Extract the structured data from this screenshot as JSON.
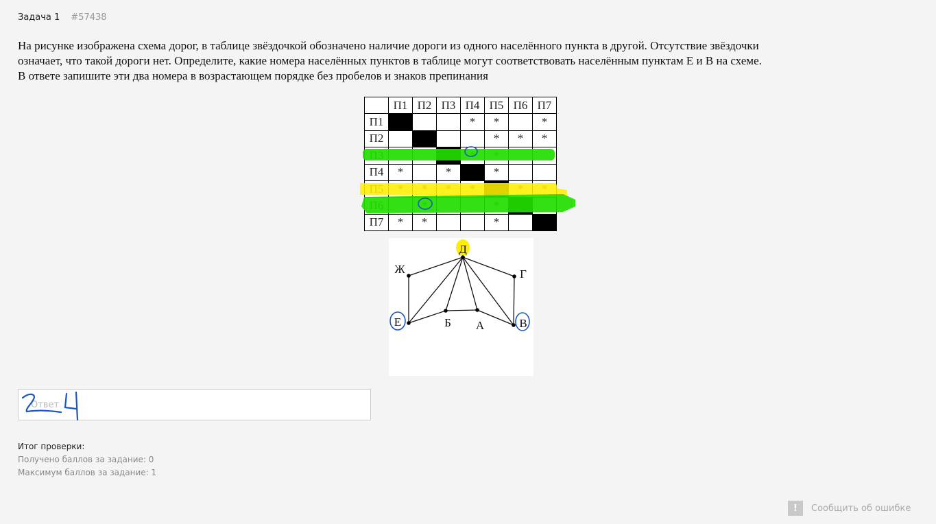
{
  "task": {
    "title": "Задача 1",
    "number": "#57438"
  },
  "question": {
    "line1": "На рисунке изображена схема дорог, в таблице звёздочкой обозначено наличие дороги из одного населённого пункта в другой. Отсутствие звёздочки",
    "line2": "означает, что такой дороги нет. Определите, какие номера населённых пунктов в таблице могут соответствовать населённым пунктам Е и В на схеме.",
    "line3": "В ответе запишите эти два номера в возрастающем порядке без пробелов и знаков препинания"
  },
  "table": {
    "headers": [
      "",
      "П1",
      "П2",
      "П3",
      "П4",
      "П5",
      "П6",
      "П7"
    ],
    "rows": [
      [
        "П1",
        "#",
        "",
        "",
        "*",
        "*",
        "",
        "*"
      ],
      [
        "П2",
        "",
        "#",
        "",
        "",
        "*",
        "*",
        "*"
      ],
      [
        "П3",
        "",
        "",
        "#",
        "*",
        "*",
        "",
        ""
      ],
      [
        "П4",
        "*",
        "",
        "*",
        "#",
        "*",
        "",
        ""
      ],
      [
        "П5",
        "*",
        "*",
        "*",
        "*",
        "#",
        "*",
        "*"
      ],
      [
        "П6",
        "",
        "*",
        "",
        "",
        "*",
        "#",
        ""
      ],
      [
        "П7",
        "*",
        "*",
        "",
        "",
        "*",
        "",
        "#"
      ]
    ]
  },
  "graph": {
    "nodes": [
      "Д",
      "Ж",
      "Г",
      "Е",
      "Б",
      "А",
      "В"
    ],
    "edges": [
      [
        "Д",
        "Ж"
      ],
      [
        "Д",
        "Г"
      ],
      [
        "Д",
        "Е"
      ],
      [
        "Д",
        "Б"
      ],
      [
        "Д",
        "А"
      ],
      [
        "Д",
        "В"
      ],
      [
        "Ж",
        "Е"
      ],
      [
        "Г",
        "В"
      ],
      [
        "Е",
        "Б"
      ],
      [
        "Б",
        "А"
      ],
      [
        "А",
        "В"
      ]
    ]
  },
  "colors": {
    "highlight_green": "#22dd00",
    "highlight_yellow": "#ffee00",
    "pen_blue": "#1a56c4"
  },
  "answer": {
    "placeholder": "Ответ",
    "handwritten": "24"
  },
  "result": {
    "heading": "Итог проверки:",
    "received": "Получено баллов за задание: 0",
    "max": "Максимум баллов за задание: 1"
  },
  "report": {
    "icon": "!",
    "label": "Сообщить об ошибке"
  }
}
